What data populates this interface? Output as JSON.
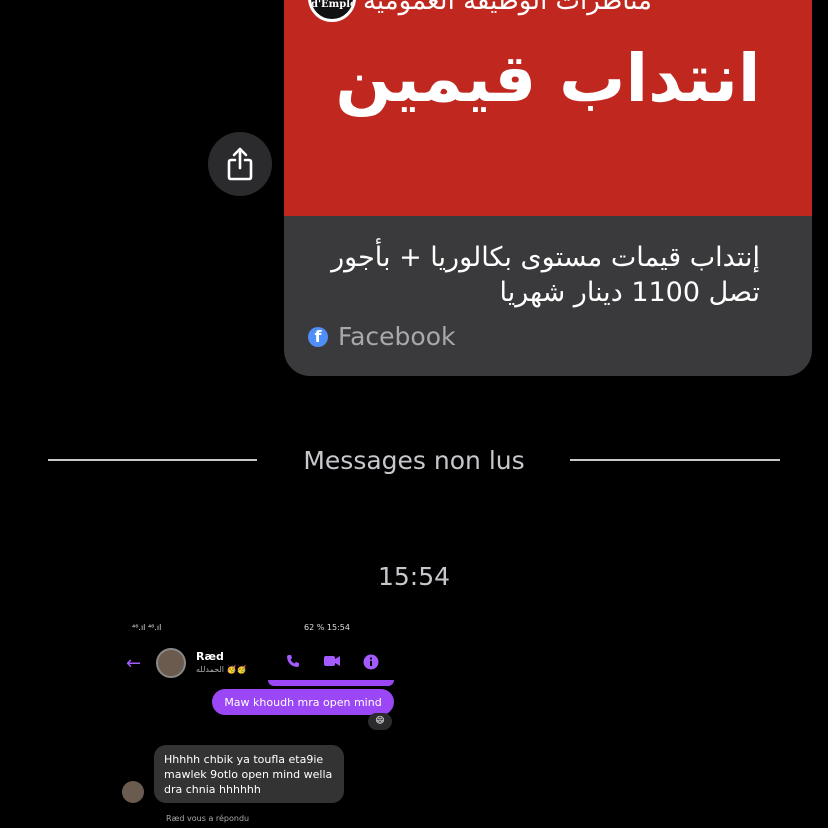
{
  "shared_post": {
    "page_name": "مناظرات الوظيفة العمومية",
    "page_avatar_text": "d'Emploi",
    "hero_text": "انتداب قيمين",
    "title": "إنتداب قيمات مستوى بكالوريا +  بأجور تصل 1100 دينار شهريا",
    "source": "Facebook",
    "hero_color": "#c0271f"
  },
  "share_button": {
    "icon": "share-icon"
  },
  "divider": {
    "label": "Messages non lus"
  },
  "timestamp": "15:54",
  "embedded_screenshot": {
    "status_left": "⁴⁶.ıl ⁴⁶.ıl",
    "status_right": "62 % 15:54",
    "contact_name": "Ræd",
    "contact_status": "الحمدلله 🥳🥳",
    "outgoing_message": "Maw khoudh mra open mind",
    "reaction": "😄",
    "incoming_message": "Hhhhh chbik ya toufla eta9ie mawlek 9otlo open mind wella dra chnia hhhhhh",
    "reply_note": "Ræd vous a répondu",
    "accent_color": "#9b47f5"
  }
}
